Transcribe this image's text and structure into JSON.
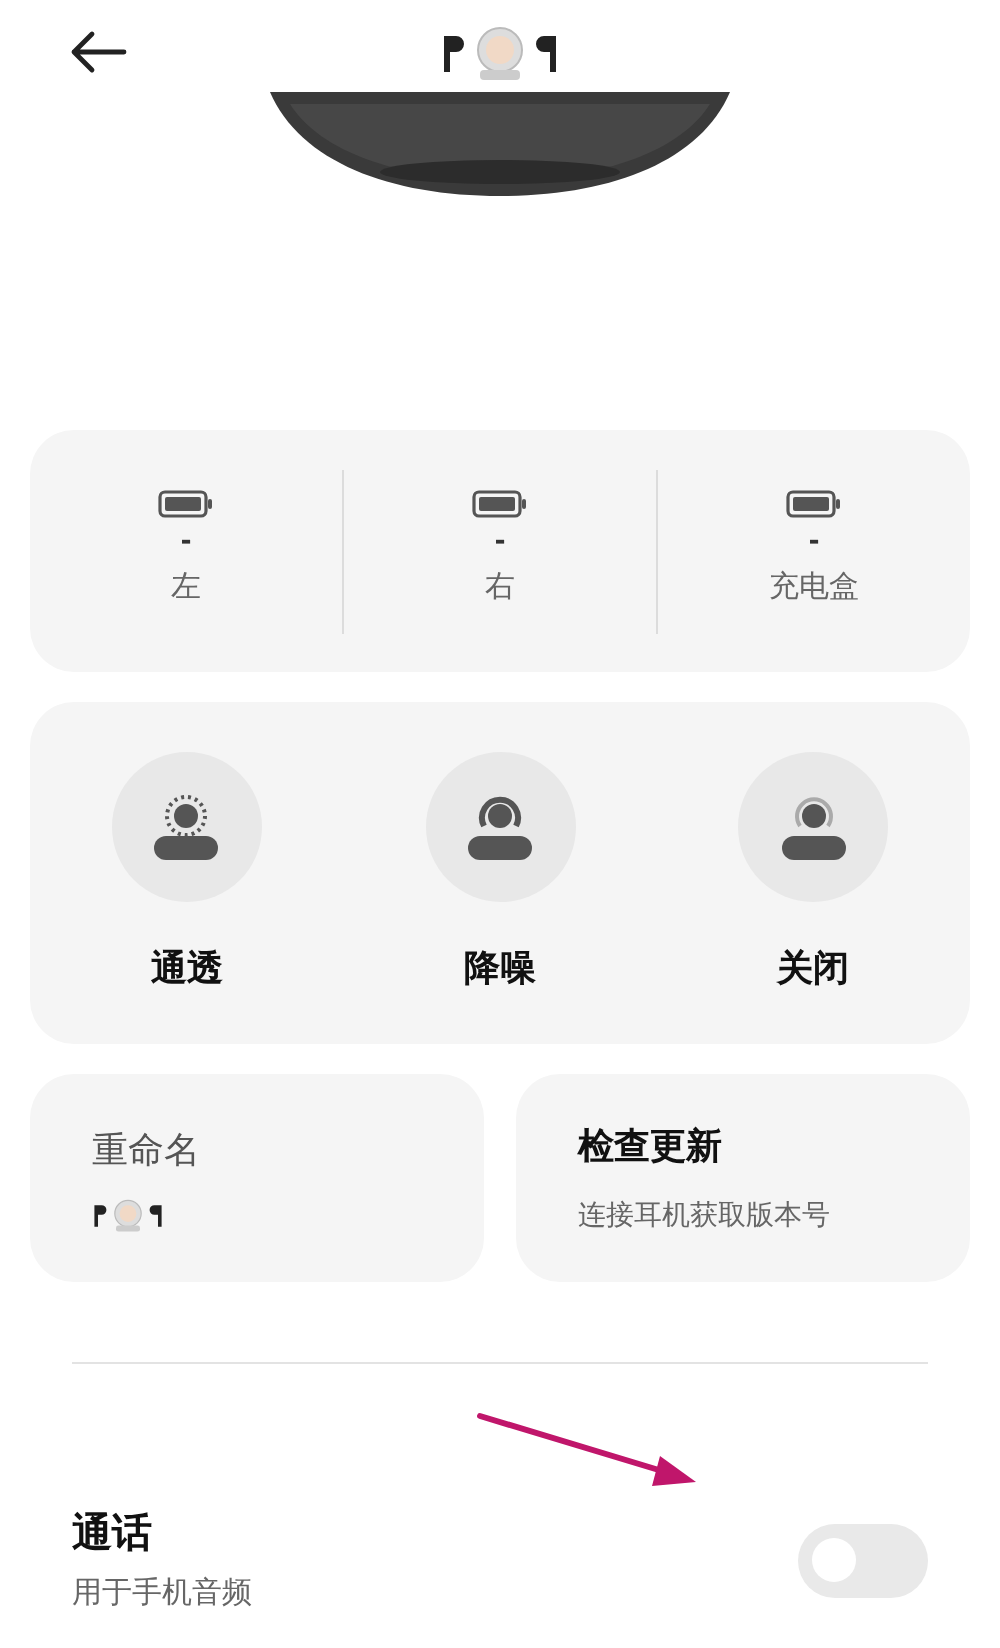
{
  "batteries": [
    {
      "value": "-",
      "label": "左"
    },
    {
      "value": "-",
      "label": "右"
    },
    {
      "value": "-",
      "label": "充电盒"
    }
  ],
  "modes": [
    {
      "kind": "transparency",
      "label": "通透",
      "selected": false
    },
    {
      "kind": "noise_cancel",
      "label": "降噪",
      "selected": false
    },
    {
      "kind": "off",
      "label": "关闭",
      "selected": false
    }
  ],
  "rename": {
    "title": "重命名"
  },
  "update": {
    "title": "检查更新",
    "subtitle": "连接耳机获取版本号"
  },
  "call": {
    "title": "通话",
    "subtitle": "用于手机音频",
    "on": false
  }
}
